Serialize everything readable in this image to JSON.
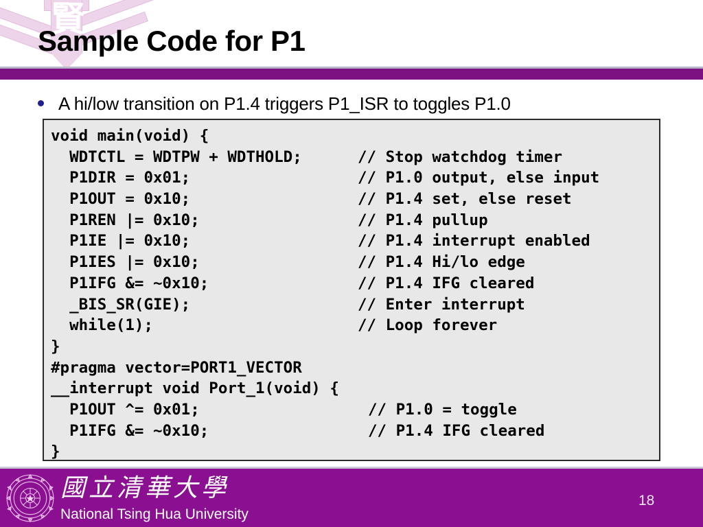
{
  "slide": {
    "title": "Sample Code for P1",
    "page_number": "18",
    "accent_color": "#8a0f91",
    "title_rule_color": "#7c1182",
    "bullet_color": "#1f1f8f",
    "code_bg_color": "#e8e8e8",
    "watermark_color": "#edd4ea"
  },
  "watermark": {
    "glyph": "賢",
    "name": "nthu-emblem-watermark"
  },
  "bullet": {
    "text": "A hi/low transition on P1.4 triggers P1_ISR to toggles P1.0"
  },
  "code": {
    "lines": [
      {
        "code": "void main(void) {",
        "comment": ""
      },
      {
        "code": "  WDTCTL = WDTPW + WDTHOLD;",
        "comment": "// Stop watchdog timer"
      },
      {
        "code": "  P1DIR = 0x01;",
        "comment": "// P1.0 output, else input"
      },
      {
        "code": "  P1OUT = 0x10;",
        "comment": "// P1.4 set, else reset"
      },
      {
        "code": "  P1REN |= 0x10;",
        "comment": "// P1.4 pullup"
      },
      {
        "code": "  P1IE |= 0x10;",
        "comment": "// P1.4 interrupt enabled"
      },
      {
        "code": "  P1IES |= 0x10;",
        "comment": "// P1.4 Hi/lo edge"
      },
      {
        "code": "  P1IFG &= ~0x10;",
        "comment": "// P1.4 IFG cleared"
      },
      {
        "code": "  _BIS_SR(GIE);",
        "comment": "// Enter interrupt"
      },
      {
        "code": "  while(1);",
        "comment": "// Loop forever"
      },
      {
        "code": "}",
        "comment": ""
      },
      {
        "code": "#pragma vector=PORT1_VECTOR",
        "comment": ""
      },
      {
        "code": "__interrupt void Port_1(void) {",
        "comment": ""
      },
      {
        "code": "  P1OUT ^= 0x01;",
        "comment": "// P1.0 = toggle",
        "indent": "deep"
      },
      {
        "code": "  P1IFG &= ~0x10;",
        "comment": "// P1.4 IFG cleared",
        "indent": "deep"
      },
      {
        "code": "}",
        "comment": ""
      }
    ]
  },
  "footer": {
    "chinese_name": "國立清華大學",
    "english_name": "National Tsing Hua University",
    "seal_label": "TSING HUA UNIVERSITY"
  }
}
